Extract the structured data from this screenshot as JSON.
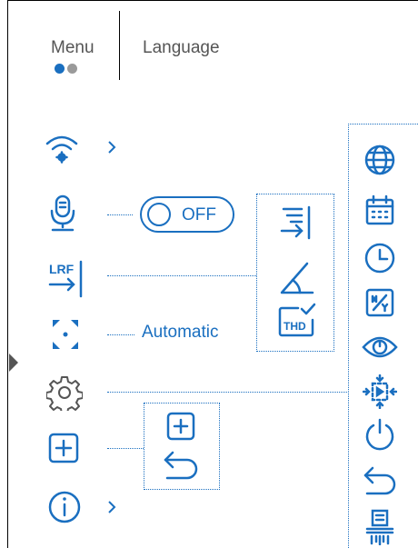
{
  "header": {
    "tab_menu": "Menu",
    "tab_language": "Language",
    "page_indicator": {
      "current": 1,
      "total": 2
    }
  },
  "left_menu": [
    {
      "icon": "wifi-settings-icon",
      "has_submenu": true
    },
    {
      "icon": "microphone-icon",
      "toggle": {
        "label": "OFF",
        "state": "off"
      }
    },
    {
      "icon": "lrf-icon",
      "text": "LRF"
    },
    {
      "icon": "autofocus-icon",
      "value": "Automatic"
    },
    {
      "icon": "gear-icon"
    },
    {
      "icon": "add-icon"
    },
    {
      "icon": "info-icon",
      "has_submenu": true
    }
  ],
  "lrf_submenu": [
    "list-mode-icon",
    "angle-icon",
    "thd-icon"
  ],
  "lrf_thd_text": "THD",
  "lrf_label": "LRF",
  "add_submenu": [
    "add-icon",
    "back-icon"
  ],
  "right_menu": [
    "globe-icon",
    "calendar-icon",
    "clock-icon",
    "date-format-icon",
    "eye-icon",
    "pixel-calibration-icon",
    "power-icon",
    "back-icon",
    "reset-icon"
  ],
  "colors": {
    "accent": "#1a6fc0",
    "text": "#555555"
  }
}
